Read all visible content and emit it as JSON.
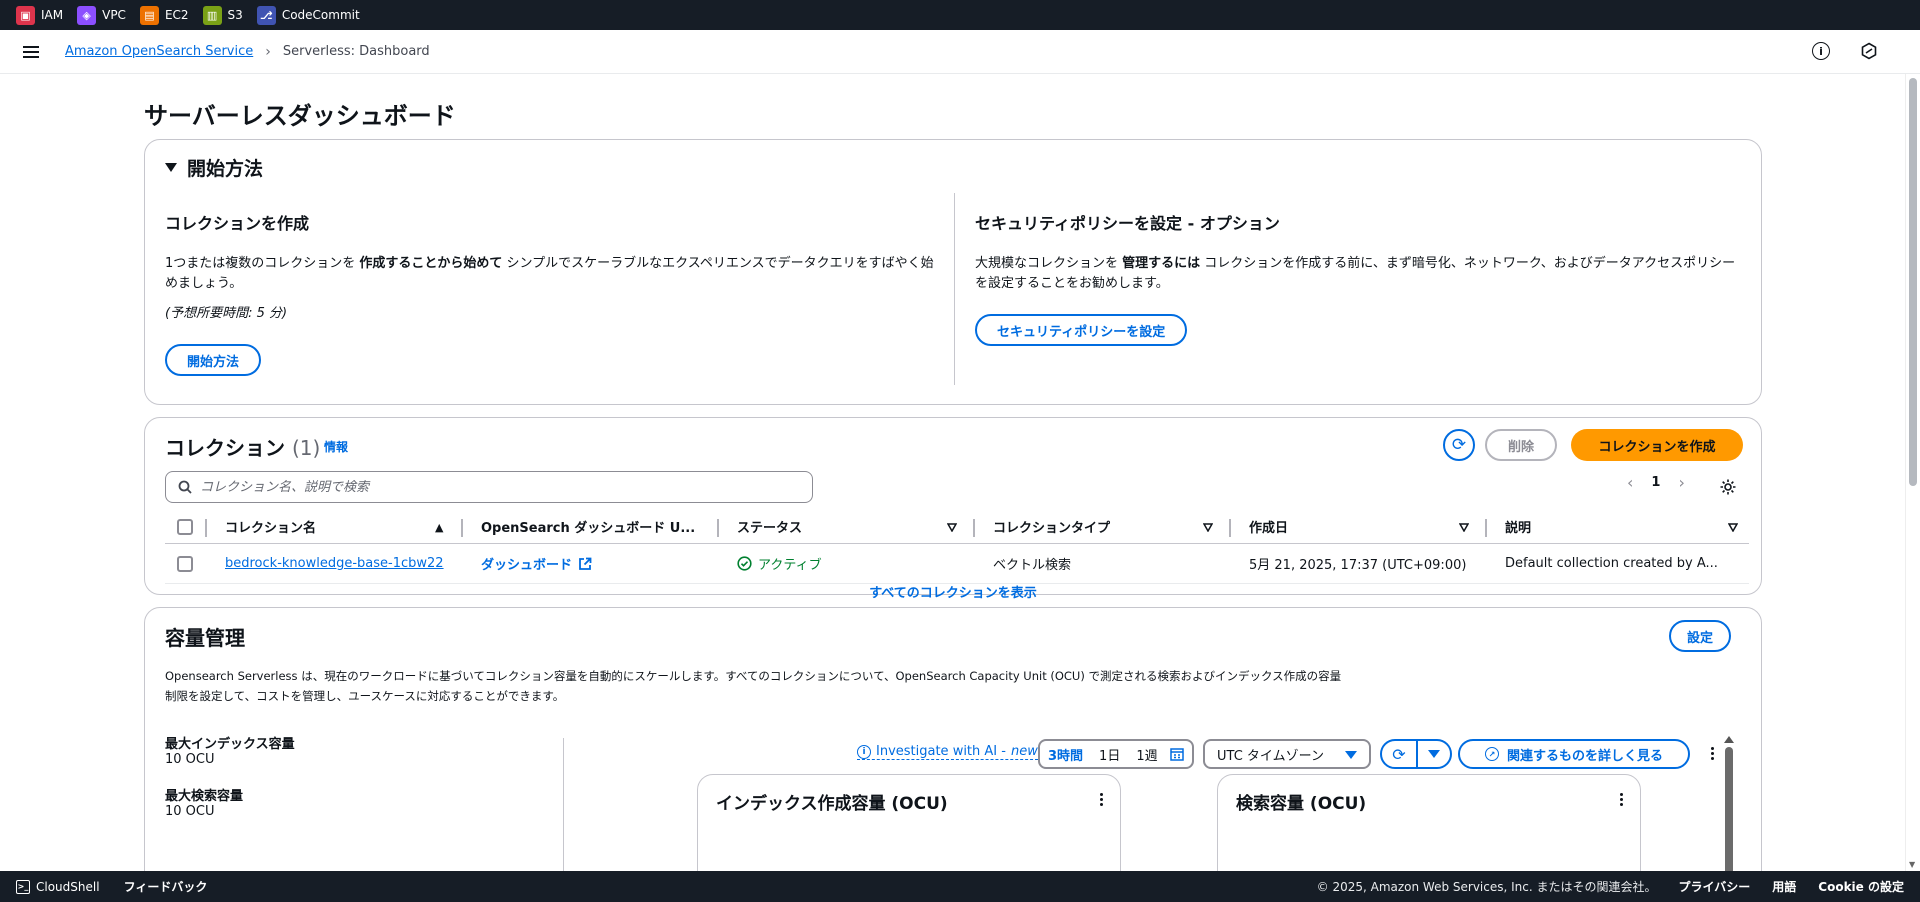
{
  "topbar": {
    "services": [
      {
        "label": "IAM",
        "icon": "iam-icon",
        "color": "#dd344c"
      },
      {
        "label": "VPC",
        "icon": "vpc-icon",
        "color": "#8c4fff"
      },
      {
        "label": "EC2",
        "icon": "ec2-icon",
        "color": "#ed7100"
      },
      {
        "label": "S3",
        "icon": "s3-icon",
        "color": "#7aa116"
      },
      {
        "label": "CodeCommit",
        "icon": "codecommit-icon",
        "color": "#4054b2"
      }
    ]
  },
  "breadcrumb": {
    "service": "Amazon OpenSearch Service",
    "current": "Serverless: Dashboard"
  },
  "page": {
    "title": "サーバーレスダッシュボード"
  },
  "getting_started": {
    "heading": "開始方法",
    "create": {
      "title": "コレクションを作成",
      "text_a": "1つまたは複数のコレクションを ",
      "text_b": "作成することから始めて",
      "text_c": " シンプルでスケーラブルなエクスペリエンスでデータクエリをすばやく始めましょう。",
      "time": "(予想所要時間: 5 分)",
      "button": "開始方法"
    },
    "security": {
      "title": "セキュリティポリシーを設定 - オプション",
      "text_a": "大規模なコレクションを ",
      "text_b": "管理するには",
      "text_c": " コレクションを作成する前に、まず暗号化、ネットワーク、およびデータアクセスポリシーを設定することをお勧めします。",
      "button": "セキュリティポリシーを設定"
    }
  },
  "collections": {
    "title": "コレクション",
    "count": "(1)",
    "info": "情報",
    "delete_button": "削除",
    "create_button": "コレクションを作成",
    "search_placeholder": "コレクション名、説明で検索",
    "page": "1",
    "columns": [
      "コレクション名",
      "OpenSearch ダッシュボード U...",
      "ステータス",
      "コレクションタイプ",
      "作成日",
      "説明"
    ],
    "rows": [
      {
        "name": "bedrock-knowledge-base-1cbw22",
        "dashboard": "ダッシュボード",
        "status": "アクティブ",
        "type": "ベクトル検索",
        "created": "5月 21, 2025, 17:37 (UTC+09:00)",
        "description": "Default collection created by A..."
      }
    ],
    "show_all": "すべてのコレクションを表示"
  },
  "capacity": {
    "title": "容量管理",
    "settings_button": "設定",
    "desc_line1": "Opensearch Serverless は、現在のワークロードに基づいてコレクション容量を自動的にスケールします。すべてのコレクションについて、OpenSearch Capacity Unit (OCU) で測定される検索およびインデックス作成の容量",
    "desc_line2": "制限を設定して、コストを管理し、ユースケースに対応することができます。",
    "max_index_label": "最大インデックス容量",
    "max_index_value": "10 OCU",
    "max_search_label": "最大検索容量",
    "max_search_value": "10 OCU",
    "ai_link": "Investigate with AI -",
    "ai_new": "new",
    "ranges": [
      "3時間",
      "1日",
      "1週"
    ],
    "timezone": "UTC タイムゾーン",
    "explore_button": "関連するものを詳しく見る",
    "chart1_title": "インデックス作成容量 (OCU)",
    "chart2_title": "検索容量 (OCU)"
  },
  "footer": {
    "cloudshell": "CloudShell",
    "feedback": "フィードバック",
    "copyright": "© 2025, Amazon Web Services, Inc. またはその関連会社。",
    "privacy": "プライバシー",
    "terms": "用語",
    "cookies": "Cookie の設定"
  }
}
